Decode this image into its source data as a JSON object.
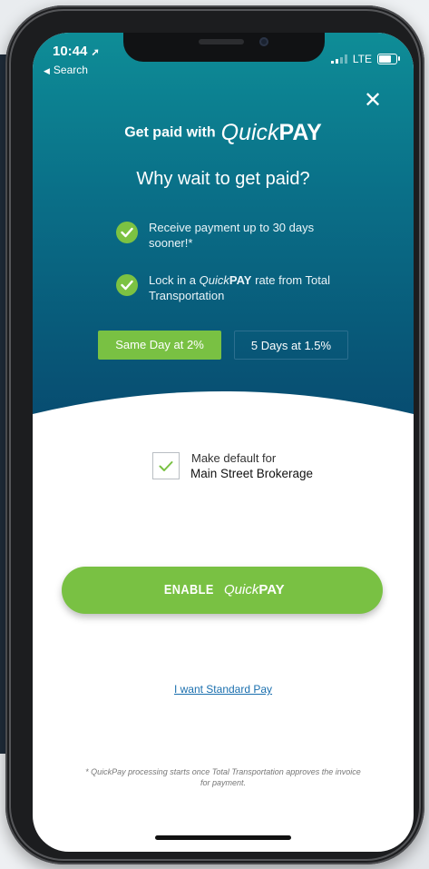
{
  "status_bar": {
    "time": "10:44",
    "back_label": "Search",
    "carrier": "LTE"
  },
  "modal": {
    "close_label": "✕",
    "brand_lead": "Get paid with",
    "brand_quick": "Quick",
    "brand_pay": "PAY",
    "headline": "Why wait to get paid?",
    "benefits": [
      {
        "text": "Receive payment up to 30 days sooner!*"
      },
      {
        "prefix": "Lock in a",
        "quick": "Quick",
        "pay": "PAY",
        "suffix": "rate from Total Transportation"
      }
    ],
    "options": [
      {
        "label": "Same Day at 2%",
        "selected": true
      },
      {
        "label": "5 Days at 1.5%",
        "selected": false
      }
    ],
    "default_checkbox": {
      "checked": true,
      "line1": "Make default for",
      "line2": "Main Street Brokerage"
    },
    "enable_button": {
      "word": "ENABLE",
      "quick": "Quick",
      "pay": "PAY"
    },
    "standard_link": "I want Standard Pay",
    "footnote": "* QuickPay processing starts once Total Transportation approves the invoice for payment."
  },
  "colors": {
    "accent_green": "#79c143",
    "hero_top": "#0e8d97",
    "hero_bottom": "#074a6f",
    "link_blue": "#1a6fae"
  }
}
